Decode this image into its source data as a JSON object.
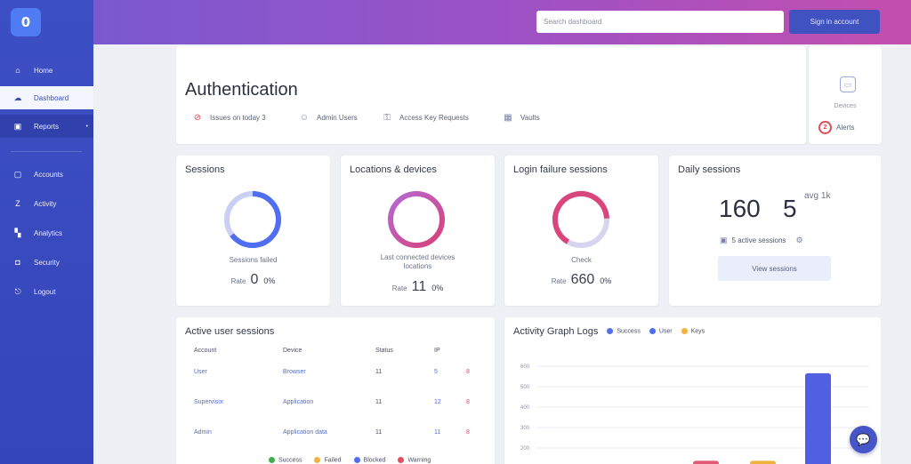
{
  "sidebar": {
    "logo_glyph": "0",
    "items": [
      {
        "label": "Home",
        "icon": "home-icon"
      },
      {
        "label": "Dashboard",
        "icon": "cloud-icon",
        "active": true
      },
      {
        "label": "Reports",
        "icon": "calendar-icon"
      },
      {
        "label": "Accounts",
        "icon": "square-icon"
      },
      {
        "label": "Activity",
        "icon": "z-icon"
      },
      {
        "label": "Analytics",
        "icon": "chart-icon"
      },
      {
        "label": "Security",
        "icon": "lock-icon"
      },
      {
        "label": "Logout",
        "icon": "logout-icon"
      }
    ]
  },
  "header": {
    "search_placeholder": "Search dashboard",
    "button_label": "Sign in account"
  },
  "auth": {
    "title": "Authentication",
    "meta": [
      {
        "text": "Issues on today 3",
        "icon": "alert-icon"
      },
      {
        "text": "Admin Users",
        "icon": "users-icon"
      },
      {
        "text": "Access Key Requests",
        "icon": "key-icon"
      },
      {
        "text": "Vaults",
        "icon": "vault-icon"
      }
    ]
  },
  "side_panel": {
    "label": "Devices",
    "row_badge": "2",
    "row_label": "Alerts"
  },
  "cards": [
    {
      "title": "Sessions",
      "label": "Sessions failed",
      "stat_prefix": "Rate",
      "stat_value": "0",
      "stat_unit": "0%"
    },
    {
      "title": "Locations & devices",
      "label": "Last connected devices locations",
      "stat_prefix": "Rate",
      "stat_value": "11",
      "stat_unit": "0%"
    },
    {
      "title": "Login failure sessions",
      "label": "Check",
      "stat_prefix": "Rate",
      "stat_value": "660",
      "stat_unit": "0%"
    },
    {
      "title": "Daily sessions",
      "big_value": "160",
      "big_value_2": "5",
      "big_unit": "avg 1k",
      "row_label": "5 active sessions",
      "button_label": "View sessions"
    }
  ],
  "logs": {
    "title": "Active user sessions",
    "columns": [
      "Account",
      "Device",
      "Status",
      "IP",
      ""
    ],
    "rows": [
      [
        "User",
        "Browser",
        "11",
        "5",
        "8"
      ],
      [
        "Supervisor",
        "Application",
        "11",
        "12",
        "8"
      ],
      [
        "Admin",
        "Application data",
        "11",
        "11",
        "8"
      ]
    ],
    "legend": [
      {
        "label": "Success",
        "color": "#3fae4e"
      },
      {
        "label": "Failed",
        "color": "#f3b23d"
      },
      {
        "label": "Blocked",
        "color": "#4f6ef0"
      },
      {
        "label": "Warning",
        "color": "#e0515e"
      }
    ]
  },
  "chart_data": {
    "type": "bar",
    "title": "Activity Graph Logs",
    "series": [
      {
        "name": "Success",
        "color": "#5a6ee5",
        "values": [
          null,
          null,
          500
        ]
      },
      {
        "name": "User",
        "color": "#4f6ef0",
        "values": [
          null,
          null,
          null
        ]
      },
      {
        "name": "Keys",
        "color": "#f1b23d",
        "values": [
          null,
          40,
          null
        ]
      }
    ],
    "bars": [
      {
        "value": 40,
        "color": "#e05a76"
      },
      {
        "value": 40,
        "color": "#f1b23d"
      },
      {
        "value": 500,
        "color": "#5060e0"
      }
    ],
    "ylim": [
      0,
      700
    ],
    "yticks": [
      "600",
      "500",
      "400",
      "300",
      "200"
    ],
    "grid": true,
    "legend_position": "top"
  }
}
